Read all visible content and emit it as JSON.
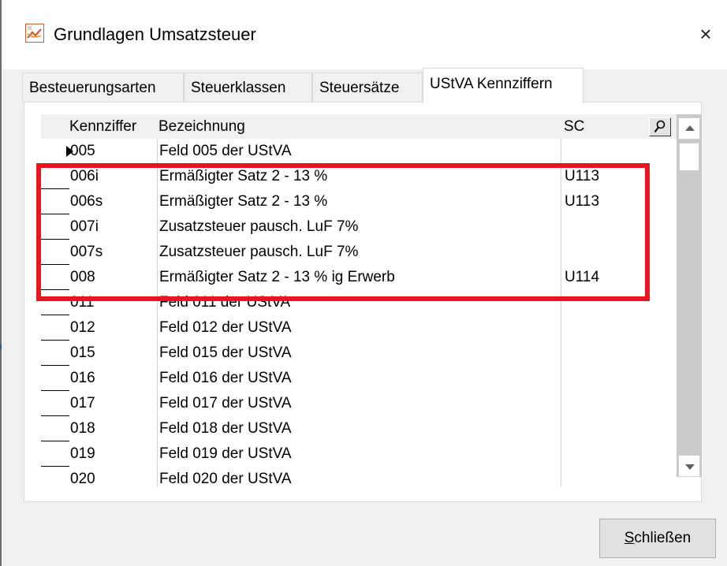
{
  "window": {
    "title": "Grundlagen Umsatzsteuer",
    "close_glyph": "×",
    "app_icon": "app-chart-icon"
  },
  "tabs": [
    {
      "label": "Besteuerungsarten",
      "active": false
    },
    {
      "label": "Steuerklassen",
      "active": false
    },
    {
      "label": "Steuersätze",
      "active": false
    },
    {
      "label": "UStVA Kennziffern",
      "active": true
    }
  ],
  "grid": {
    "columns": [
      "Kennziffer",
      "Bezeichnung",
      "SC"
    ],
    "search_icon": "search-icon",
    "rows": [
      {
        "code": "005",
        "name": "Feld 005 der UStVA",
        "sc": "",
        "current": true
      },
      {
        "code": "006i",
        "name": "Ermäßigter Satz 2 - 13 %",
        "sc": "U113",
        "current": false
      },
      {
        "code": "006s",
        "name": "Ermäßigter Satz 2 - 13 %",
        "sc": "U113",
        "current": false
      },
      {
        "code": "007i",
        "name": "Zusatzsteuer pausch. LuF 7%",
        "sc": "",
        "current": false
      },
      {
        "code": "007s",
        "name": "Zusatzsteuer pausch. LuF 7%",
        "sc": "",
        "current": false
      },
      {
        "code": "008",
        "name": "Ermäßigter Satz 2 - 13 % ig Erwerb",
        "sc": "U114",
        "current": false
      },
      {
        "code": "011",
        "name": "Feld 011 der UStVA",
        "sc": "",
        "current": false
      },
      {
        "code": "012",
        "name": "Feld 012 der UStVA",
        "sc": "",
        "current": false
      },
      {
        "code": "015",
        "name": "Feld 015 der UStVA",
        "sc": "",
        "current": false
      },
      {
        "code": "016",
        "name": "Feld 016 der UStVA",
        "sc": "",
        "current": false
      },
      {
        "code": "017",
        "name": "Feld 017 der UStVA",
        "sc": "",
        "current": false
      },
      {
        "code": "018",
        "name": "Feld 018 der UStVA",
        "sc": "",
        "current": false
      },
      {
        "code": "019",
        "name": "Feld 019 der UStVA",
        "sc": "",
        "current": false
      },
      {
        "code": "020",
        "name": "Feld 020 der UStVA",
        "sc": "",
        "current": false
      }
    ]
  },
  "annotation": {
    "highlight_color": "#e8141e"
  },
  "footer": {
    "close_button_mnemonic": "S",
    "close_button_rest": "chließen"
  }
}
